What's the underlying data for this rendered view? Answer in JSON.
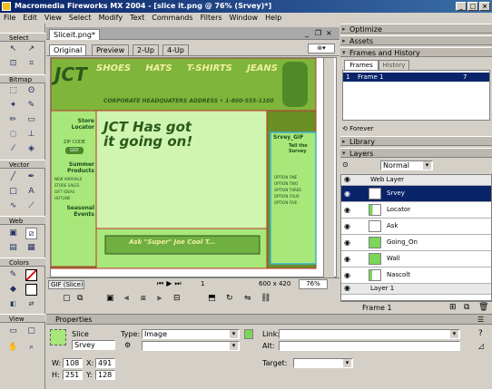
{
  "window": {
    "title": "Macromedia Fireworks MX 2004 - [slice it.png @ 76% (Srvey)*]"
  },
  "menu": [
    "File",
    "Edit",
    "View",
    "Select",
    "Modify",
    "Text",
    "Commands",
    "Filters",
    "Window",
    "Help"
  ],
  "toolbox": {
    "sections": [
      "Select",
      "Bitmap",
      "Vector",
      "Web",
      "Colors",
      "View"
    ]
  },
  "document": {
    "tab": "Sliceit.png*",
    "view_tabs": [
      "Original",
      "Preview",
      "2-Up",
      "4-Up"
    ],
    "status_format": "GIF (Slice)",
    "status_page": "1",
    "status_size": "600 x 420",
    "status_zoom": "76%"
  },
  "canvas": {
    "banner_items": [
      "SHOES",
      "HATS",
      "T-SHIRTS",
      "JEANS"
    ],
    "logo_text": "JCT",
    "subtitle": "CORPORATE HEADQUATERS ADDRESS • 1-800-555-1100",
    "left": {
      "store_locator": "Store Locator",
      "zip_label": "ZIP CODE",
      "go": "GO!",
      "summer_products": "Summer Products",
      "items": [
        "NEW ARRIVALS",
        "STORE SALES",
        "GIFT IDEAS",
        "HOTLINE"
      ],
      "seasonal": "Seasonal Events"
    },
    "headline_1": "JCT Has got",
    "headline_2": "it going on!",
    "right": {
      "survey": "Srvey_GIF",
      "title": "Tell the Survey",
      "items": [
        "OPTION ONE",
        "OPTION TWO",
        "OPTION THREE",
        "OPTION FOUR",
        "OPTION FIVE"
      ]
    },
    "wall_text": "Ask \"Super\" Joe Cool T..."
  },
  "panels": {
    "optimize": "Optimize",
    "assets": "Assets",
    "frames_history": "Frames and History",
    "frames_tab": "Frames",
    "history_tab": "History",
    "frame_row": {
      "num": "1",
      "name": "Frame 1",
      "delay": "7"
    },
    "forever": "Forever",
    "library": "Library",
    "layers": "Layers",
    "blend": "Normal",
    "opacity": "100",
    "web_layer": "Web Layer",
    "slices": [
      "Srvey",
      "Locator",
      "Ask",
      "Going_On",
      "Wall",
      "Nascolt"
    ],
    "layer1": "Layer 1",
    "frame_label": "Frame 1"
  },
  "properties": {
    "title": "Properties",
    "object_type": "Slice",
    "name_value": "Srvey",
    "type_label": "Type:",
    "type_value": "Image",
    "link_label": "Link:",
    "alt_label": "Alt:",
    "target_label": "Target:",
    "w_label": "W:",
    "w_value": "108",
    "h_label": "H:",
    "h_value": "251",
    "x_label": "X:",
    "x_value": "491",
    "y_label": "Y:",
    "y_value": "128"
  },
  "colors": {
    "accent": "#0a246a",
    "slice_green": "#7bd65a",
    "selected_row": "#0a246a"
  }
}
